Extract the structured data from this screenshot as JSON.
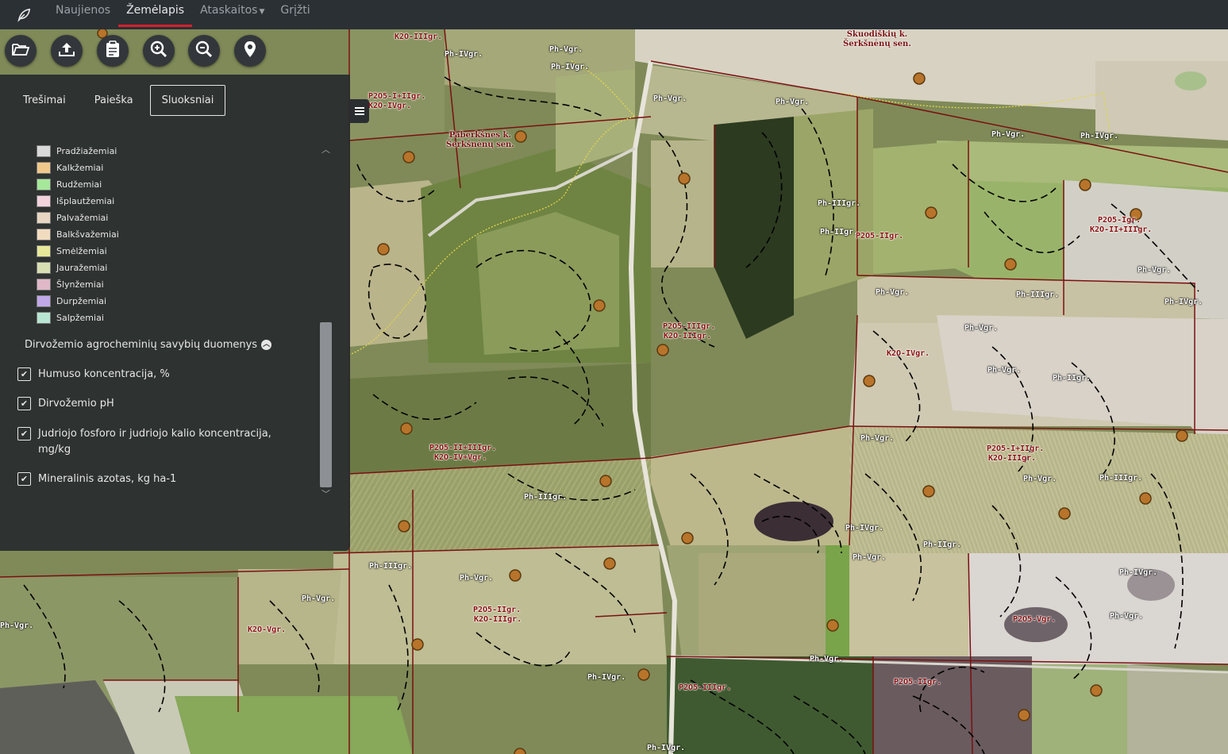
{
  "nav": {
    "logo_icon": "leaf-icon",
    "items": [
      {
        "label": "Naujienos"
      },
      {
        "label": "Žemėlapis"
      },
      {
        "label": "Ataskaitos"
      },
      {
        "label": "Grįžti"
      }
    ]
  },
  "toolbar": {
    "icons": [
      "folder-open-icon",
      "upload-icon",
      "clipboard-icon",
      "zoom-in-icon",
      "zoom-out-icon",
      "map-pin-icon"
    ]
  },
  "panel": {
    "tabs": [
      {
        "label": "Trešimai"
      },
      {
        "label": "Paieška"
      },
      {
        "label": "Sluoksniai"
      }
    ],
    "legend": [
      {
        "label": "Pradžiažemiai",
        "color": "#d9d9d9"
      },
      {
        "label": "Kalkžemiai",
        "color": "#f0c98a"
      },
      {
        "label": "Rudžemiai",
        "color": "#a6e89a"
      },
      {
        "label": "Išplautžemiai",
        "color": "#f2d3dc"
      },
      {
        "label": "Palvažemiai",
        "color": "#e6d6c2"
      },
      {
        "label": "Balkšvažemiai",
        "color": "#f2dcc0"
      },
      {
        "label": "Smėlžemiai",
        "color": "#e8e89a"
      },
      {
        "label": "Jauražemiai",
        "color": "#d8dfb2"
      },
      {
        "label": "Šlynžemiai",
        "color": "#e0b8c8"
      },
      {
        "label": "Durpžemiai",
        "color": "#c0a8e8"
      },
      {
        "label": "Salpžemiai",
        "color": "#b8e6d2"
      }
    ],
    "section_title": "Dirvožemio agrocheminių savybių duomenys",
    "checks": [
      {
        "label": "Humuso koncentracija, %",
        "checked": true
      },
      {
        "label": "Dirvožemio pH",
        "checked": true
      },
      {
        "label": "Judriojo fosforo ir judriojo kalio koncentracija,",
        "label2": "mg/kg",
        "checked": true
      },
      {
        "label": "Mineralinis azotas, kg ha-1",
        "checked": true
      }
    ]
  },
  "map": {
    "places": [
      {
        "line1": "Skuodiškių k.",
        "line2": "Šerkšnėnų sen."
      },
      {
        "line1": "Paberkšnės k.",
        "line2": "Šerkšnėnų sen."
      }
    ],
    "labels": [
      "Ph-IVgr.",
      "Ph-Vgr.",
      "Ph-IVgr.",
      "Ph-Vgr.",
      "Ph-IIIgr.",
      "Ph-Vgr.",
      "Ph-IIgr.",
      "Ph-Vgr.",
      "Ph-IVgr.",
      "Ph-Vgr.",
      "Ph-IIIgr.",
      "Ph-Vgr.",
      "Ph-Vgr.",
      "Ph-IIgr.",
      "Ph-IVgr.",
      "Ph-Vgr.",
      "Ph-IVgr.",
      "Ph-Vgr.",
      "Ph-IIIgr.",
      "Ph-Vgr.",
      "Ph-IVgr.",
      "Ph-Vgr.",
      "Ph-IIgr.",
      "Ph-Vgr.",
      "Ph-IIIgr.",
      "Ph-Vgr.",
      "Ph-IVgr.",
      "Ph-Vgr.",
      "Ph-Vgr.",
      "Ph-IIIgr.",
      "Ph-Vgr.",
      "Ph-IVgr."
    ],
    "red_labels": [
      "K2O-IIIgr.",
      "P2O5-I+IIgr.",
      "K2O-IVgr.",
      "P2O5-IIgr.",
      "K2O-IIIgr.",
      "P2O5-IIIgr.",
      "K2O-IVgr.",
      "P2O5-II+IIIgr.",
      "K2O-IV+Vgr.",
      "P2O5-Igr.",
      "K2O-II+IIIgr.",
      "P2O5-IIgr.",
      "K2O-IIIgr.",
      "P2O5-I+IIgr.",
      "K2O-IIIgr.",
      "P2O5-IIIgr.",
      "K2O-Vgr.",
      "P2O5-IIgr.",
      "P2O5-Vgr."
    ]
  }
}
